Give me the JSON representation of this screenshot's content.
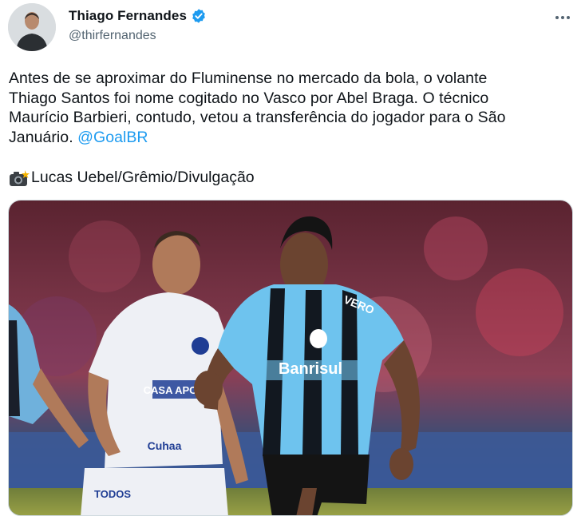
{
  "author": {
    "name": "Thiago Fernandes",
    "handle": "@thirfernandes",
    "verified": true
  },
  "tweet": {
    "line1": "Antes de se aproximar do Fluminense no mercado da bola, o volante",
    "line2": "Thiago Santos foi nome cogitado no Vasco por Abel Braga. O técnico",
    "line3": "Maurício Barbieri, contudo, vetou a transferência do jogador para o São",
    "line4": "Januário.",
    "mention": "@GoalBR",
    "credit_icon": "camera-flash-icon",
    "credit": "Lucas Uebel/Grêmio/Divulgação"
  },
  "photo": {
    "jersey_sponsor": "Banrisul",
    "jersey_sleeve": "VERO",
    "opponent_sponsor_1": "CASA APOSTA",
    "opponent_sponsor_2": "Cuhaa",
    "opponent_shorts": "TODOS"
  },
  "colors": {
    "accent": "#1d9bf0",
    "text": "#0f1419",
    "secondary": "#536471"
  }
}
